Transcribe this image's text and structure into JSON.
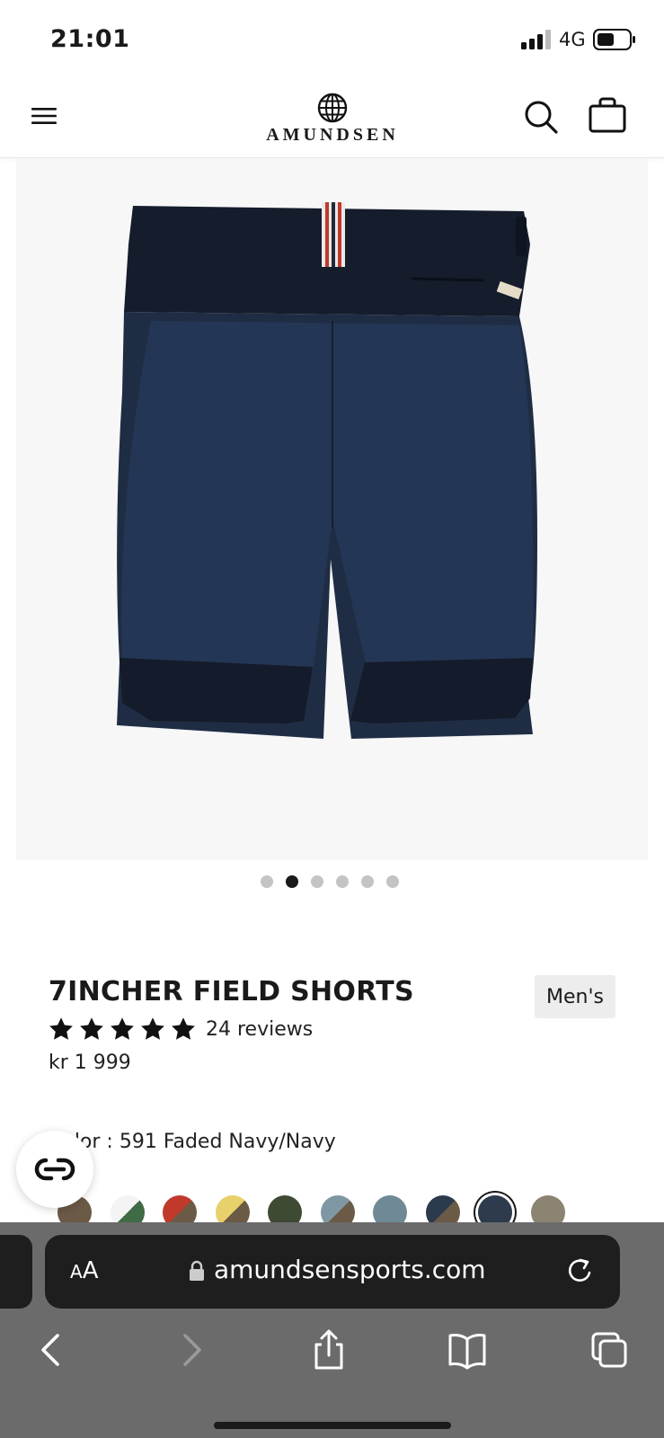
{
  "status_bar": {
    "time": "21:01",
    "network": "4G"
  },
  "header": {
    "brand": "AMUNDSEN"
  },
  "gallery": {
    "image_count": 6,
    "active_index": 1
  },
  "product": {
    "title": "7INCHER FIELD SHORTS",
    "gender": "Men's",
    "rating_stars": 5,
    "reviews": "24 reviews",
    "price": "kr 1 999",
    "color_label": "Color : 591 Faded Navy/Navy"
  },
  "swatches": [
    {
      "top": "#6b5a46",
      "bottom": "#6b5a46"
    },
    {
      "top": "#f4f4f4",
      "bottom": "#3f6b45"
    },
    {
      "top": "#c0392b",
      "bottom": "#6b5a46"
    },
    {
      "top": "#e8d06a",
      "bottom": "#6b5a46"
    },
    {
      "top": "#3e4a34",
      "bottom": "#3e4a34"
    },
    {
      "top": "#7f97a3",
      "bottom": "#6b5a46"
    },
    {
      "top": "#6f8a96",
      "bottom": "#6f8a96"
    },
    {
      "top": "#2c3a4e",
      "bottom": "#6b5a46"
    },
    {
      "top": "#2e3b4d",
      "bottom": "#2e3b4d"
    },
    {
      "top": "#8c8472",
      "bottom": "#8c8472"
    }
  ],
  "selected_swatch": 8,
  "browser": {
    "text_size": "AA",
    "url": "amundsensports.com"
  },
  "colors": {
    "navy": "#1f2a3a",
    "accent": "#c0392b"
  }
}
